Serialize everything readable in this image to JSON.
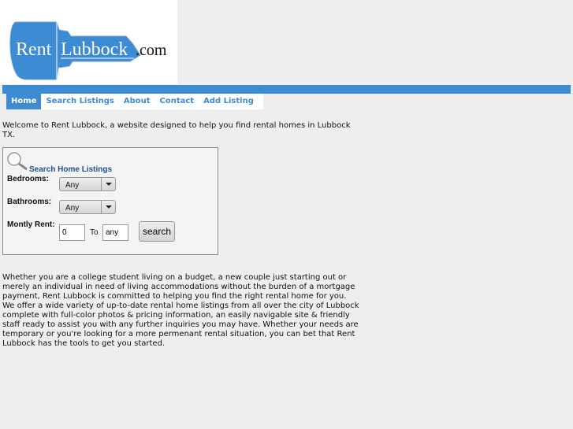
{
  "logo": {
    "text_rent": "Rent",
    "text_lubbock": "Lubbock",
    ".com": ".com",
    "brand_color": "#3d8bd3"
  },
  "nav": [
    {
      "label": "Home",
      "active": true
    },
    {
      "label": "Search Listings"
    },
    {
      "label": "About"
    },
    {
      "label": "Contact"
    },
    {
      "label": "Add Listing"
    }
  ],
  "welcome": "Welcome to Rent Lubbock, a website designed to help you find rental homes in Lubbock TX.",
  "search": {
    "title": "Search Home Listings",
    "bedrooms_label": "Bedrooms:",
    "bedrooms_value": "Any",
    "bathrooms_label": "Bathrooms:",
    "bathrooms_value": "Any",
    "rent_label": "Montly Rent:",
    "rent_min": "0",
    "to_label": "To",
    "rent_max": "any",
    "button": "search"
  },
  "paragraph": "Whether you are a college student living on a budget, a new couple just starting out or merely an individual in need of living accommodations without the burden of a mortgage payment, Rent Lubbock is committed to helping you find the right rental home for you. We offer a wide variety of up-to-date rental home listings from all over the city of Lubbock complete with full-color photos & pricing information, an easily navigable site & friendly staff ready to assist you with any further inquiries you may have. Whether your needs are temporary or you're looking for a more permenant rental situation, you can bet that Rent Lubbock has the tools to get you started."
}
